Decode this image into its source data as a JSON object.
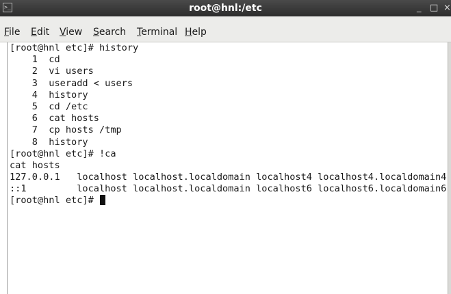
{
  "window": {
    "title": "root@hnl:/etc",
    "icon": "terminal-icon",
    "minimize_label": "_",
    "maximize_label": "□",
    "close_label": "×"
  },
  "menu": {
    "file": {
      "mnemonic": "F",
      "rest": "ile"
    },
    "edit": {
      "mnemonic": "E",
      "rest": "dit"
    },
    "view": {
      "mnemonic": "V",
      "rest": "iew"
    },
    "search": {
      "mnemonic": "S",
      "rest": "earch"
    },
    "terminal": {
      "mnemonic": "T",
      "rest": "erminal"
    },
    "help": {
      "mnemonic": "H",
      "rest": "elp"
    }
  },
  "terminal": {
    "lines": [
      "[root@hnl etc]# history",
      "    1  cd",
      "    2  vi users",
      "    3  useradd < users",
      "    4  history",
      "    5  cd /etc",
      "    6  cat hosts",
      "    7  cp hosts /tmp",
      "    8  history",
      "[root@hnl etc]# !ca",
      "cat hosts",
      "127.0.0.1   localhost localhost.localdomain localhost4 localhost4.localdomain4",
      "::1         localhost localhost.localdomain localhost6 localhost6.localdomain6"
    ],
    "prompt": "[root@hnl etc]# "
  }
}
